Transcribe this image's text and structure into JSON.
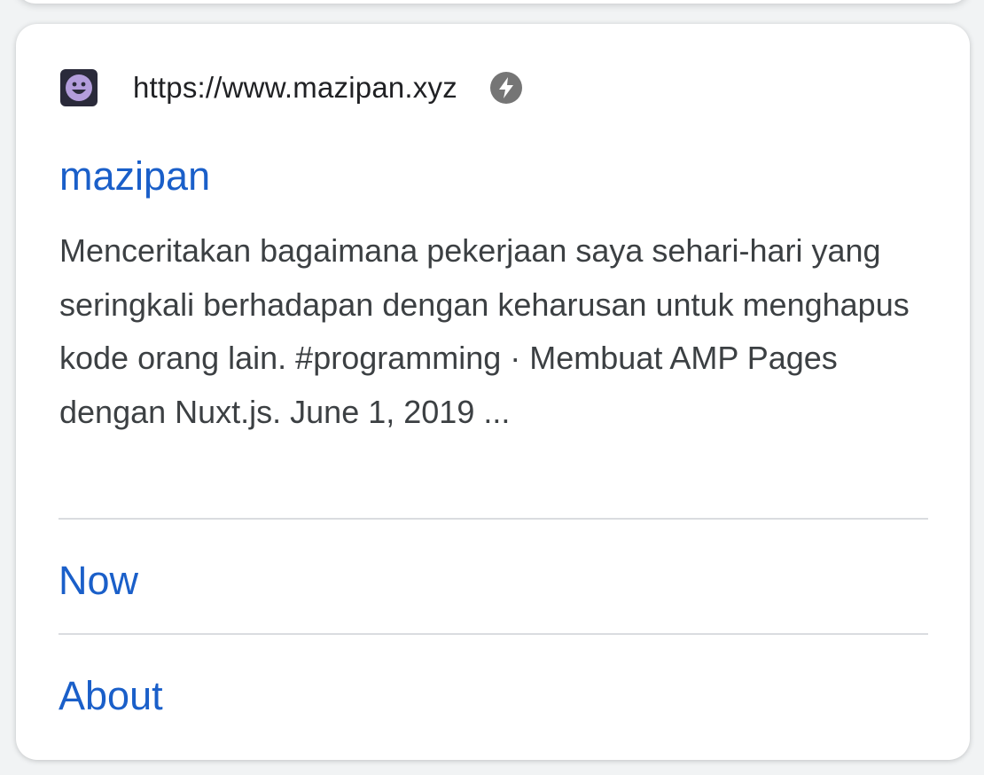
{
  "result": {
    "favicon_icon": "smiley-avatar-icon",
    "site_url": "https://www.mazipan.xyz",
    "amp_icon": "amp-lightning-icon",
    "title": "mazipan",
    "snippet": "Menceritakan bagaimana pekerjaan saya sehari-hari yang seringkali berhadapan dengan keharusan untuk menghapus kode orang lain. #programming · Membuat AMP Pages dengan Nuxt.js. June 1, 2019 ..."
  },
  "sitelinks": [
    {
      "label": "Now"
    },
    {
      "label": "About"
    }
  ],
  "colors": {
    "link": "#1a5fc9",
    "text": "#3c4043",
    "url": "#202124",
    "divider": "#dadce0",
    "favicon_face": "#b39ddb"
  }
}
